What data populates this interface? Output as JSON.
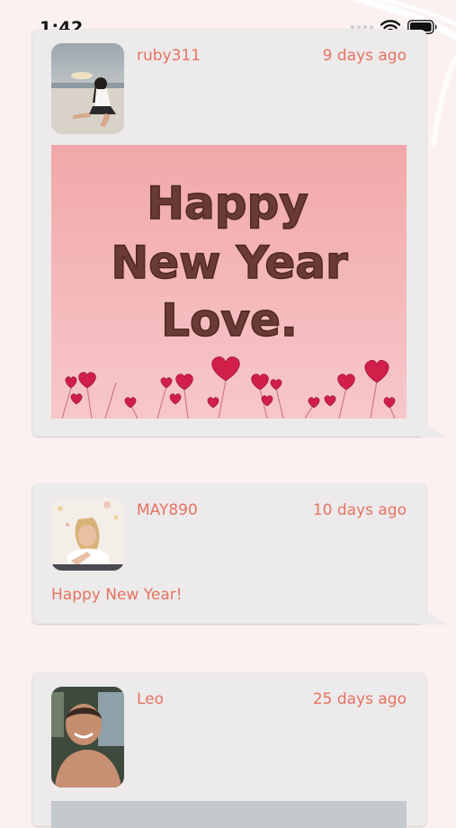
{
  "status_bar": {
    "time": "1:42",
    "icons": [
      "cellular-icon",
      "wifi-icon",
      "battery-icon"
    ]
  },
  "colors": {
    "background": "#fbf1f0",
    "card": "#eceaea",
    "accent": "#e77262"
  },
  "posts": [
    {
      "username": "ruby311",
      "time_ago": "9 days ago",
      "text": "",
      "image": {
        "type": "greeting-card",
        "lines": [
          "Happy",
          "New Year",
          "Love."
        ]
      }
    },
    {
      "username": "MAY890",
      "time_ago": "10 days ago",
      "text": "Happy New Year!"
    },
    {
      "username": "Leo",
      "time_ago": "25 days ago",
      "text": ""
    }
  ]
}
